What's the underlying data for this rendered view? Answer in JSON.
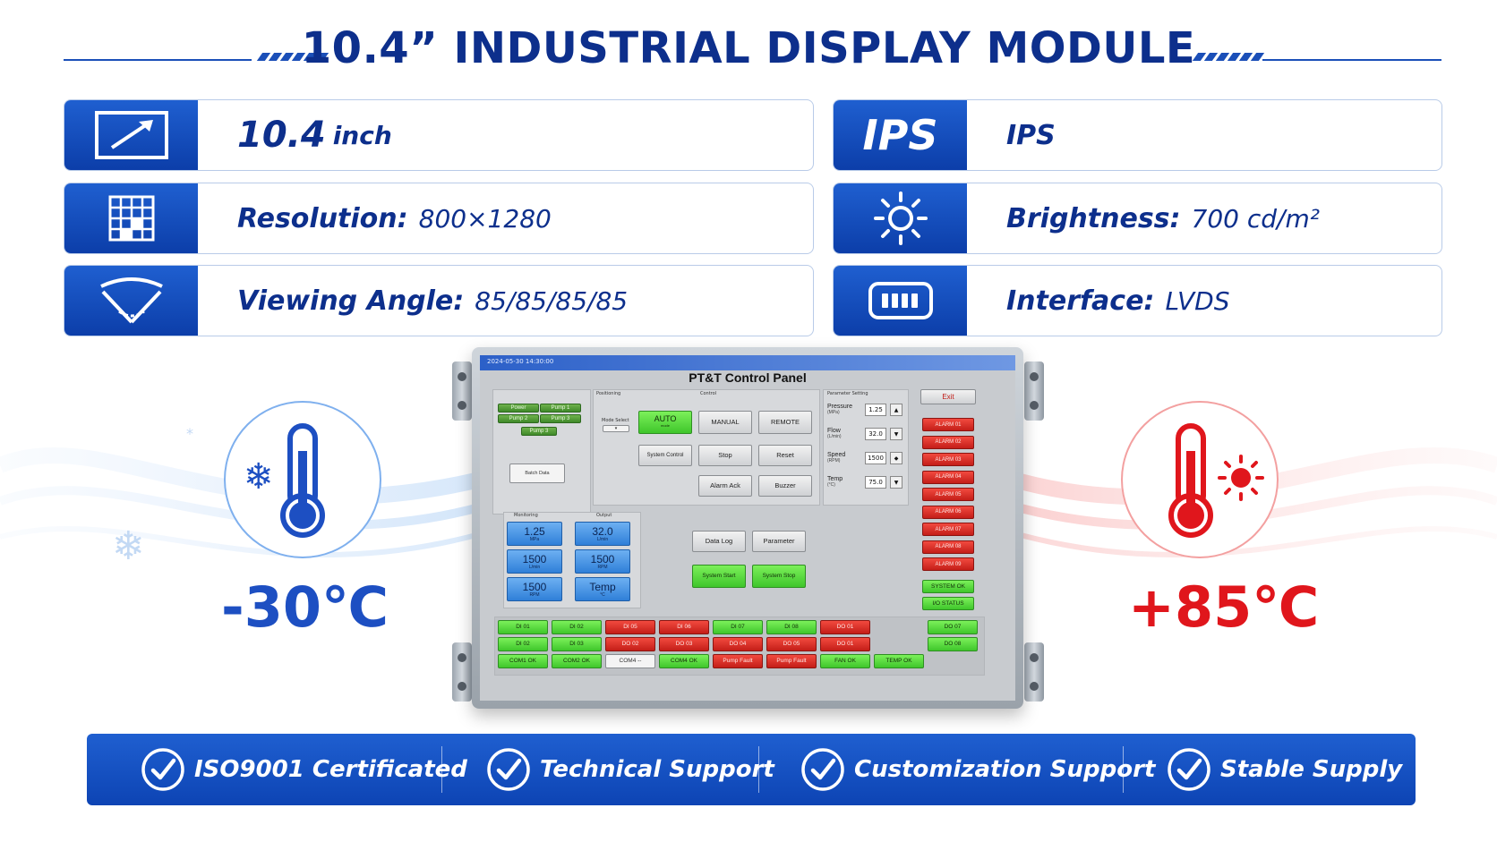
{
  "header": {
    "title": "10.4” INDUSTRIAL DISPLAY MODULE"
  },
  "specs": {
    "size": {
      "value": "10.4",
      "unit": "inch",
      "icon": "resize-arrow-icon"
    },
    "panel": {
      "icon_text": "IPS",
      "value": "IPS"
    },
    "resolution": {
      "label": "Resolution:",
      "value": "800×1280",
      "icon": "pixel-grid-icon"
    },
    "brightness": {
      "label": "Brightness:",
      "value": "700 cd/m²",
      "icon": "sun-icon"
    },
    "viewing_angle": {
      "label": "Viewing Angle:",
      "value": "85/85/85/85",
      "icon": "viewing-angle-icon"
    },
    "interface": {
      "label": "Interface:",
      "value": "LVDS",
      "icon": "connector-icon"
    }
  },
  "temperature": {
    "min": "-30℃",
    "max": "+85℃",
    "cold_color": "#1d4fc2",
    "hot_color": "#e0161c"
  },
  "screen": {
    "timestamp": "2024-05-30 14:30:00",
    "title": "PT&T Control Panel",
    "exit_label": "Exit",
    "left_panel": {
      "pump_labels": [
        "Power",
        "Pump 1",
        "Pump 2",
        "Pump 3",
        "Pump 3"
      ],
      "small_btn": "Batch Data"
    },
    "sections": {
      "positioning": "Positioning",
      "control": "Control",
      "parameter": "Parameter Setting",
      "monitoring": "Monitoring",
      "output": "Output"
    },
    "mode_label": "Mode Select",
    "buttons": {
      "auto": "AUTO",
      "auto_sub": "mode",
      "manual": "MANUAL",
      "remote": "REMOTE",
      "system_control": "System Control",
      "stop": "Stop",
      "reset": "Reset",
      "alarm_ack": "Alarm Ack",
      "buzzer": "Buzzer",
      "data_log": "Data Log",
      "parameter": "Parameter",
      "system_start": "System Start",
      "system_stop": "System Stop"
    },
    "params": [
      {
        "name": "Pressure",
        "unit": "(MPa)",
        "value": "1.25"
      },
      {
        "name": "Flow",
        "unit": "(L/min)",
        "value": "32.0"
      },
      {
        "name": "Speed",
        "unit": "(RPM)",
        "value": "1500"
      },
      {
        "name": "Temp",
        "unit": "(°C)",
        "value": "75.0"
      }
    ],
    "monitors": [
      {
        "value": "1.25",
        "unit": "MPa"
      },
      {
        "value": "32.0",
        "unit": "L/min"
      },
      {
        "value": "1500",
        "unit": "L/min"
      },
      {
        "value": "1500",
        "unit": "RPM"
      },
      {
        "value": "1500",
        "unit": "RPM"
      },
      {
        "value": "Temp",
        "unit": "°C"
      }
    ],
    "alarms": [
      "ALARM 01",
      "ALARM 02",
      "ALARM 03",
      "ALARM 04",
      "ALARM 05",
      "ALARM 06",
      "ALARM 07",
      "ALARM 08",
      "ALARM 09"
    ],
    "status": [
      "SYSTEM OK",
      "I/O STATUS"
    ],
    "io_rows": [
      [
        "DI 01",
        "DI 02",
        "DI 05",
        "DI 06",
        "DI 07",
        "DI 08",
        "DO 01",
        "",
        "DO 07"
      ],
      [
        "DI 02",
        "DI 03",
        "DO 02",
        "DO 03",
        "DO 04",
        "DO 05",
        "DO 01",
        "",
        "DO 08"
      ],
      [
        "COM1 OK",
        "COM2 OK",
        "COM4 --",
        "COM4 OK",
        "Pump Fault",
        "Pump Fault",
        "FAN OK",
        "TEMP OK",
        ""
      ]
    ]
  },
  "footer": {
    "items": [
      "ISO9001 Certificated",
      "Technical Support",
      "Customization Support",
      "Stable Supply"
    ]
  }
}
